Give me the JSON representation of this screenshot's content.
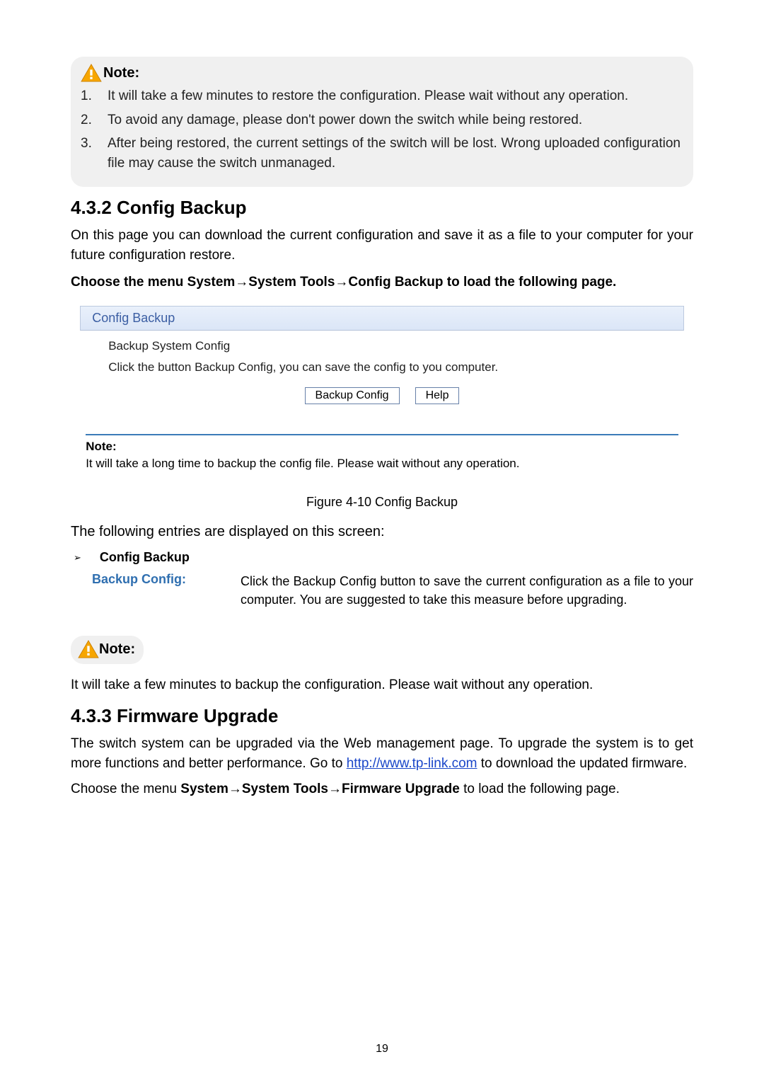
{
  "note1": {
    "label": "Note:",
    "items": [
      "It will take a few minutes to restore the configuration. Please wait without any operation.",
      "To avoid any damage, please don't power down the switch while being restored.",
      "After being restored, the current settings of the switch will be lost. Wrong uploaded configuration file may cause the switch unmanaged."
    ]
  },
  "section432": {
    "heading": "4.3.2 Config Backup",
    "intro": "On this page you can download the current configuration and save it as a file to your computer for your future configuration restore.",
    "choose": "Choose the menu System→System Tools→Config Backup to load the following page."
  },
  "ui": {
    "panel_title": "Config Backup",
    "subtitle": "Backup System Config",
    "sub_desc": "Click the button Backup Config, you can save the config to you computer.",
    "btn_backup": "Backup Config",
    "btn_help": "Help",
    "note_label": "Note:",
    "note_text": "It will take a long time to backup the config file. Please wait without any operation."
  },
  "figure_caption": "Figure 4-10 Config Backup",
  "lead_sentence": "The following entries are displayed on this screen:",
  "bullet_label": "Config Backup",
  "definition": {
    "term": "Backup Config:",
    "desc": "Click the Backup Config button to save the current configuration as a file to your computer. You are suggested to take this measure before upgrading."
  },
  "note2": {
    "label": "Note:",
    "text": "It will take a few minutes to backup the configuration. Please wait without any operation."
  },
  "section433": {
    "heading": "4.3.3 Firmware Upgrade",
    "intro_pre": "The switch system can be upgraded via the Web management page. To upgrade the system is to get more functions and better performance. Go to ",
    "link_text": "http://www.tp-link.com",
    "intro_post": " to download the updated firmware.",
    "choose_pre": "Choose the menu ",
    "choose_bold": "System→System Tools→Firmware Upgrade",
    "choose_post": " to load the following page."
  },
  "page_number": "19"
}
